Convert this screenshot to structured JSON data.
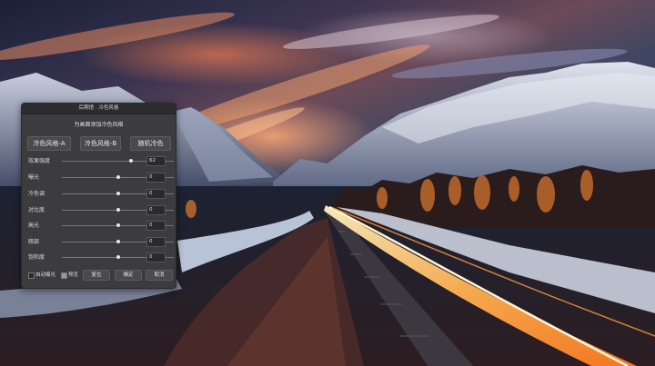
{
  "colors": {
    "dialog_bg": "#3c3c3e",
    "titlebar_bg": "#2c2c2e",
    "track": "#777777",
    "thumb": "#e6e6e6",
    "light_trail": "#ffb050"
  },
  "background": {
    "icon": "night-mountain-railway-photo"
  },
  "dialog": {
    "title": "后期馆 · 冷色风格",
    "subtitle": "为画面添加冷色风格",
    "presets": [
      {
        "label": "冷色风格-A"
      },
      {
        "label": "冷色风格-B"
      },
      {
        "label": "随机冷色"
      }
    ],
    "sliders": [
      {
        "label": "效果强度",
        "value": "62",
        "level": 0.62
      },
      {
        "label": "曝光",
        "value": "0",
        "level": 0.5
      },
      {
        "label": "冷色调",
        "value": "0",
        "level": 0.5
      },
      {
        "label": "对比度",
        "value": "0",
        "level": 0.5
      },
      {
        "label": "高光",
        "value": "0",
        "level": 0.5
      },
      {
        "label": "暗部",
        "value": "0",
        "level": 0.5
      },
      {
        "label": "饱和度",
        "value": "0",
        "level": 0.5
      }
    ],
    "auto_exposure": {
      "label": "自动曝光",
      "checked": false
    },
    "preview": {
      "label": "预览",
      "checked": true
    },
    "reset_label": "复位",
    "ok_label": "确定",
    "cancel_label": "取消"
  }
}
